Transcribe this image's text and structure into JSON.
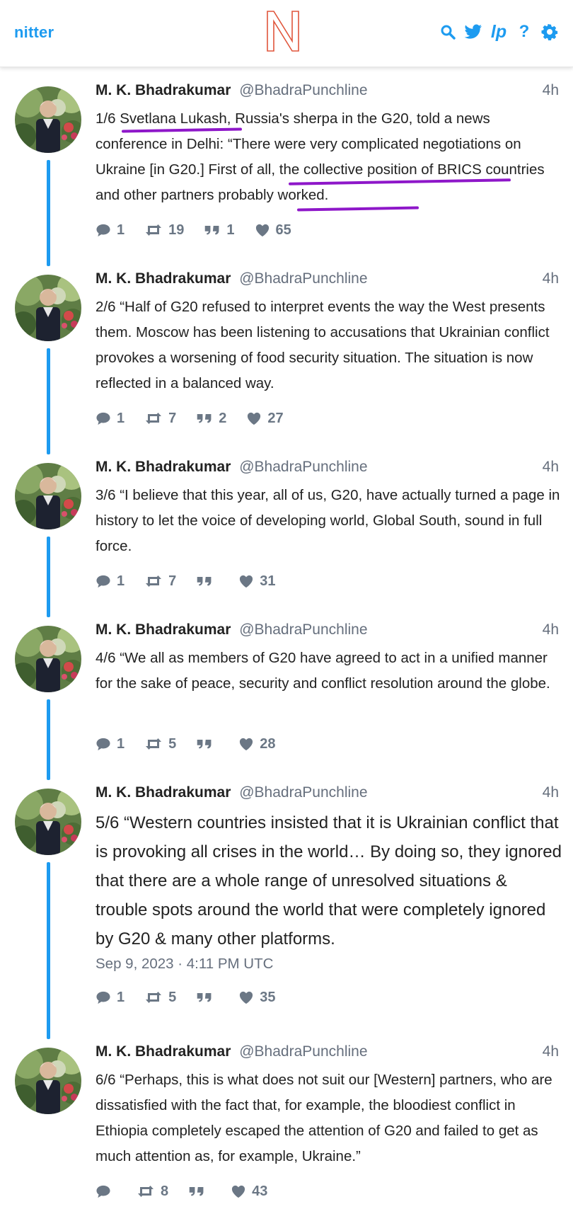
{
  "app": {
    "brand": "nitter",
    "logo_letter": "N"
  },
  "nav": {
    "icons": [
      "search-icon",
      "twitter-icon",
      "lp-icon",
      "help-icon",
      "settings-icon"
    ],
    "lp_label": "lp",
    "help_label": "?"
  },
  "colors": {
    "accent": "#1d9bf0",
    "logo": "#e0553b",
    "highlight": "#8e17c9",
    "muted": "#666f7d"
  },
  "tweets": [
    {
      "fullname": "M. K. Bhadrakumar",
      "username": "@BhadraPunchline",
      "time": "4h",
      "text": "1/6 Svetlana Lukash, Russia's sherpa in the G20, told a news conference in Delhi: “There were very complicated negotiations on Ukraine [in G20.] First of all, the collective position of BRICS countries and other partners probably worked.",
      "replies": "1",
      "retweets": "19",
      "quotes": "1",
      "likes": "65"
    },
    {
      "fullname": "M. K. Bhadrakumar",
      "username": "@BhadraPunchline",
      "time": "4h",
      "text": "2/6 “Half of G20 refused to interpret events the way the West presents them. Moscow has been listening to accusations that Ukrainian conflict provokes a worsening of food security situation. The situation is now reflected in a balanced way.",
      "replies": "1",
      "retweets": "7",
      "quotes": "2",
      "likes": "27"
    },
    {
      "fullname": "M. K. Bhadrakumar",
      "username": "@BhadraPunchline",
      "time": "4h",
      "text": "3/6 “I believe that this year, all of us, G20, have actually turned a page in history to let the voice of developing world, Global South, sound in full force.",
      "replies": "1",
      "retweets": "7",
      "quotes": "",
      "likes": "31"
    },
    {
      "fullname": "M. K. Bhadrakumar",
      "username": "@BhadraPunchline",
      "time": "4h",
      "text": "4/6 “We all as members of G20 have agreed to act in a unified manner for the sake of peace, security and conflict resolution around the globe.",
      "replies": "1",
      "retweets": "5",
      "quotes": "",
      "likes": "28"
    },
    {
      "fullname": "M. K. Bhadrakumar",
      "username": "@BhadraPunchline",
      "time": "4h",
      "text": "5/6 “Western countries insisted that it is Ukrainian conflict that is provoking all crises in the world… By doing so, they ignored that there are a whole range of unresolved situations & trouble spots around the world that were completely ignored by G20 & many other platforms.",
      "date": "Sep 9, 2023 · 4:11 PM UTC",
      "replies": "1",
      "retweets": "5",
      "quotes": "",
      "likes": "35"
    },
    {
      "fullname": "M. K. Bhadrakumar",
      "username": "@BhadraPunchline",
      "time": "4h",
      "text": "6/6 “Perhaps, this is what does not suit our [Western] partners, who are dissatisfied with the fact that, for example, the bloodiest conflict in Ethiopia completely escaped the attention of G20 and failed to get as much attention as, for example, Ukraine.”",
      "replies": "",
      "retweets": "8",
      "quotes": "",
      "likes": "43"
    }
  ]
}
